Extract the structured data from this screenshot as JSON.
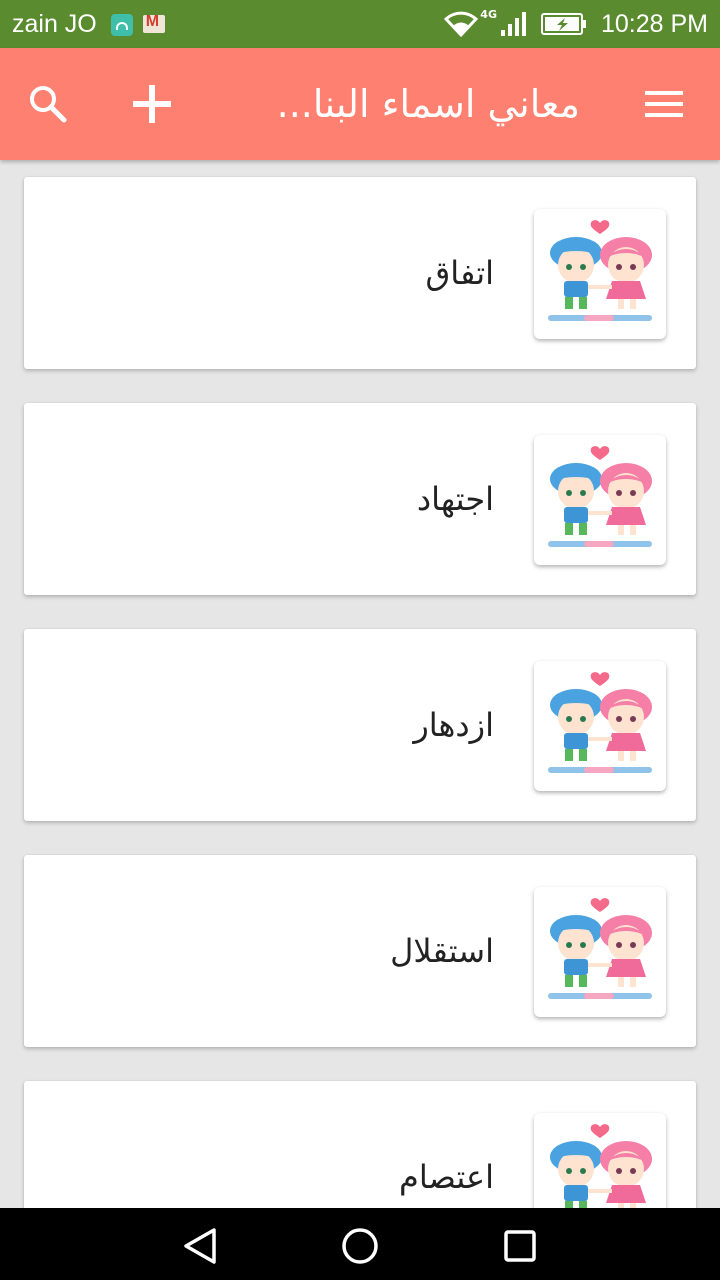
{
  "status_bar": {
    "carrier": "zain JO",
    "network": "4G",
    "time": "10:28 PM",
    "icons": [
      "android-icon",
      "gmail-icon",
      "wifi-icon",
      "signal-icon",
      "battery-charging-icon"
    ]
  },
  "app_bar": {
    "title": "معاني اسماء البنا...",
    "search_icon": "search-icon",
    "add_icon": "plus-icon",
    "menu_icon": "hamburger-menu-icon",
    "color": "#fd8070"
  },
  "list": {
    "items": [
      {
        "name": "اتفاق"
      },
      {
        "name": "اجتهاد"
      },
      {
        "name": "ازدهار"
      },
      {
        "name": "استقلال"
      },
      {
        "name": "اعتصام"
      }
    ]
  },
  "nav_bar": {
    "icons": [
      "back-icon",
      "home-icon",
      "recents-icon"
    ]
  }
}
